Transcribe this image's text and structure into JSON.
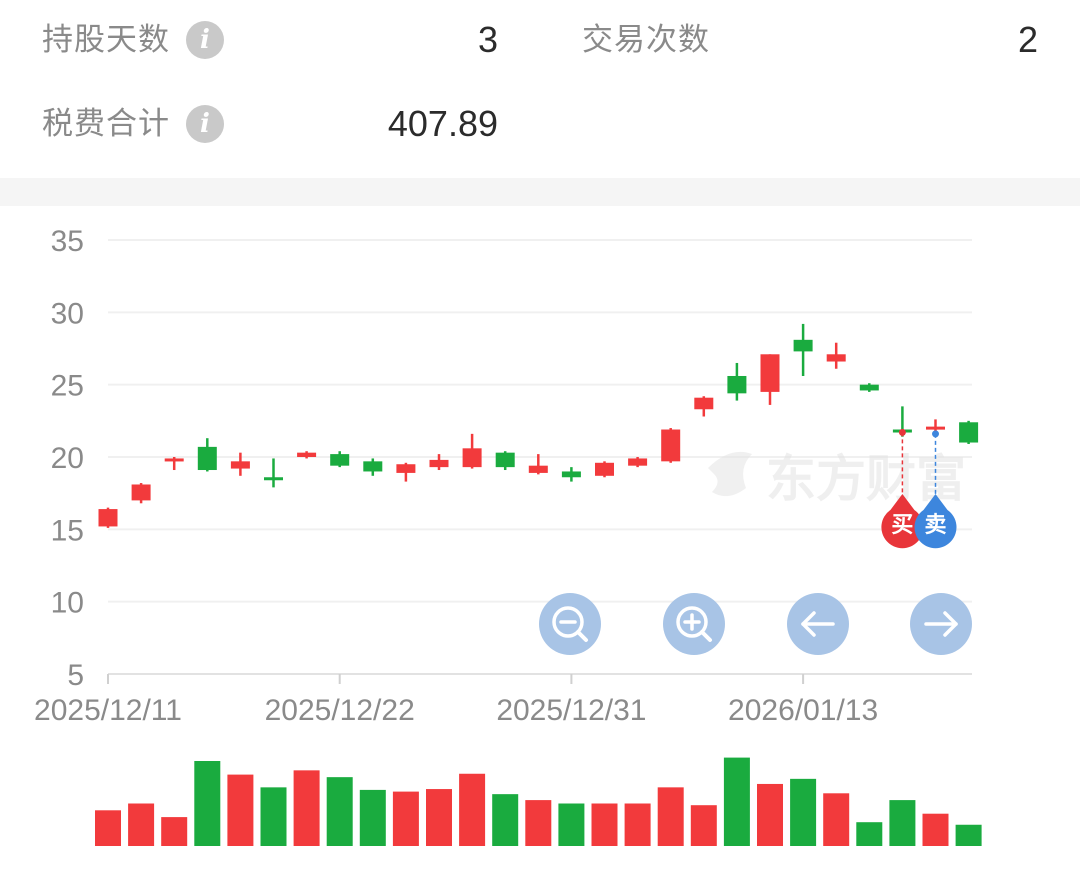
{
  "stats": {
    "holding_days_label": "持股天数",
    "holding_days_value": "3",
    "trade_count_label": "交易次数",
    "trade_count_value": "2",
    "fees_label": "税费合计",
    "fees_value": "407.89",
    "info_icon_glyph": "i"
  },
  "watermark": "东方财富",
  "markers": {
    "buy": "买",
    "sell": "卖"
  },
  "controls": [
    "zoom-out",
    "zoom-in",
    "pan-left",
    "pan-right"
  ],
  "colors": {
    "up": "#f23a3c",
    "down": "#1aab3f",
    "buy": "#e8353a",
    "sell": "#3d86dd",
    "control": "#a8c4e6"
  },
  "chart_data": {
    "type": "candlestick",
    "y_ticks": [
      "35",
      "30",
      "25",
      "20",
      "15",
      "10",
      "5"
    ],
    "ylim": [
      5,
      35
    ],
    "x_ticks": [
      {
        "index": 0,
        "label": "2025/12/11"
      },
      {
        "index": 7,
        "label": "2025/12/22"
      },
      {
        "index": 14,
        "label": "2025/12/31"
      },
      {
        "index": 21,
        "label": "2026/01/13"
      }
    ],
    "candles": [
      {
        "o": 15.2,
        "h": 16.5,
        "l": 15.1,
        "c": 16.4,
        "dir": "up"
      },
      {
        "o": 17.0,
        "h": 18.2,
        "l": 16.8,
        "c": 18.1,
        "dir": "up"
      },
      {
        "o": 19.8,
        "h": 20.0,
        "l": 19.1,
        "c": 19.9,
        "dir": "up"
      },
      {
        "o": 20.7,
        "h": 21.3,
        "l": 19.0,
        "c": 19.1,
        "dir": "down"
      },
      {
        "o": 19.2,
        "h": 20.3,
        "l": 18.7,
        "c": 19.7,
        "dir": "up"
      },
      {
        "o": 18.6,
        "h": 19.9,
        "l": 17.9,
        "c": 18.4,
        "dir": "down"
      },
      {
        "o": 20.0,
        "h": 20.4,
        "l": 19.9,
        "c": 20.3,
        "dir": "up"
      },
      {
        "o": 20.2,
        "h": 20.4,
        "l": 19.3,
        "c": 19.4,
        "dir": "down"
      },
      {
        "o": 19.7,
        "h": 19.9,
        "l": 18.7,
        "c": 19.0,
        "dir": "down"
      },
      {
        "o": 18.9,
        "h": 19.6,
        "l": 18.3,
        "c": 19.5,
        "dir": "up"
      },
      {
        "o": 19.3,
        "h": 20.2,
        "l": 19.1,
        "c": 19.8,
        "dir": "up"
      },
      {
        "o": 19.3,
        "h": 21.6,
        "l": 19.2,
        "c": 20.6,
        "dir": "up"
      },
      {
        "o": 20.3,
        "h": 20.4,
        "l": 19.1,
        "c": 19.3,
        "dir": "down"
      },
      {
        "o": 18.9,
        "h": 20.2,
        "l": 18.8,
        "c": 19.4,
        "dir": "up"
      },
      {
        "o": 19.0,
        "h": 19.3,
        "l": 18.3,
        "c": 18.6,
        "dir": "down"
      },
      {
        "o": 18.7,
        "h": 19.7,
        "l": 18.6,
        "c": 19.6,
        "dir": "up"
      },
      {
        "o": 19.4,
        "h": 20.0,
        "l": 19.3,
        "c": 19.9,
        "dir": "up"
      },
      {
        "o": 19.7,
        "h": 22.0,
        "l": 19.6,
        "c": 21.9,
        "dir": "up"
      },
      {
        "o": 23.3,
        "h": 24.2,
        "l": 22.8,
        "c": 24.1,
        "dir": "up"
      },
      {
        "o": 25.6,
        "h": 26.5,
        "l": 23.9,
        "c": 24.4,
        "dir": "down"
      },
      {
        "o": 24.5,
        "h": 27.1,
        "l": 23.6,
        "c": 27.1,
        "dir": "up"
      },
      {
        "o": 28.1,
        "h": 29.2,
        "l": 25.6,
        "c": 27.3,
        "dir": "down"
      },
      {
        "o": 26.6,
        "h": 27.9,
        "l": 26.1,
        "c": 27.1,
        "dir": "up"
      },
      {
        "o": 25.0,
        "h": 25.1,
        "l": 24.5,
        "c": 24.6,
        "dir": "down"
      },
      {
        "o": 21.9,
        "h": 23.5,
        "l": 21.4,
        "c": 21.7,
        "dir": "down"
      },
      {
        "o": 21.9,
        "h": 22.6,
        "l": 21.5,
        "c": 22.1,
        "dir": "up"
      },
      {
        "o": 22.4,
        "h": 22.5,
        "l": 20.9,
        "c": 21.0,
        "dir": "down"
      }
    ],
    "volume": [
      0.42,
      0.5,
      0.34,
      1.0,
      0.84,
      0.69,
      0.89,
      0.81,
      0.66,
      0.64,
      0.67,
      0.85,
      0.61,
      0.54,
      0.5,
      0.5,
      0.5,
      0.69,
      0.48,
      1.04,
      0.73,
      0.79,
      0.62,
      0.28,
      0.54,
      0.38,
      0.25
    ],
    "buy_index": 24,
    "buy_price": 21.7,
    "sell_index": 25,
    "sell_price": 21.6
  }
}
